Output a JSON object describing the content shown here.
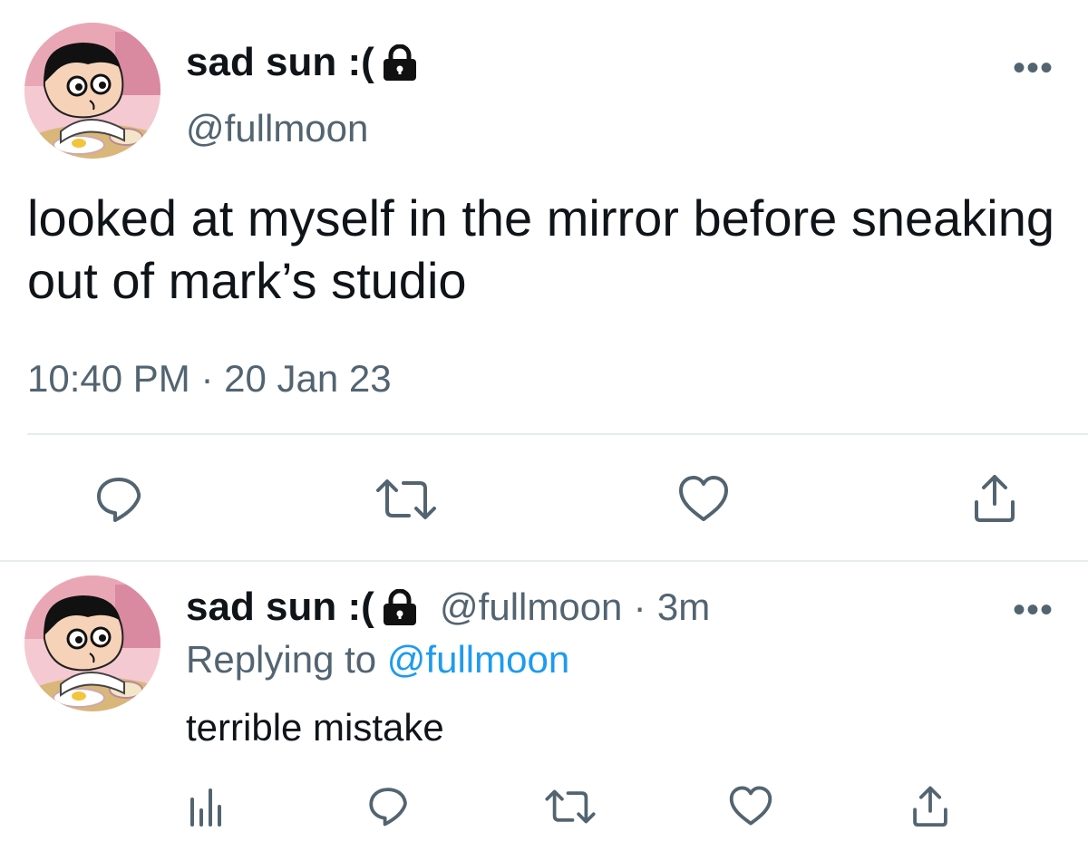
{
  "main_tweet": {
    "avatar_icon": "avatar-cartoon-boy-icon",
    "display_name": "sad sun :(",
    "lock_icon": "lock-icon",
    "handle": "@fullmoon",
    "more_icon": "more-dots-icon",
    "more_label": "•••",
    "text": "looked at myself in the mirror before sneaking out of mark’s studio",
    "time": "10:40 PM",
    "separator": "·",
    "date": "20 Jan 23",
    "actions": [
      "reply-icon",
      "retweet-icon",
      "like-icon",
      "share-icon"
    ]
  },
  "reply_tweet": {
    "avatar_icon": "avatar-cartoon-boy-icon",
    "display_name": "sad sun :(",
    "lock_icon": "lock-icon",
    "handle": "@fullmoon",
    "separator": "·",
    "age": "3m",
    "more_label": "•••",
    "replying_label": "Replying to",
    "replying_handle": "@fullmoon",
    "text": "terrible mistake",
    "actions": [
      "analytics-icon",
      "reply-icon",
      "retweet-icon",
      "like-icon",
      "share-icon"
    ]
  },
  "colors": {
    "text": "#0f1419",
    "secondary": "#536471",
    "link": "#1d9bf0",
    "divider": "#e6ecf0"
  }
}
